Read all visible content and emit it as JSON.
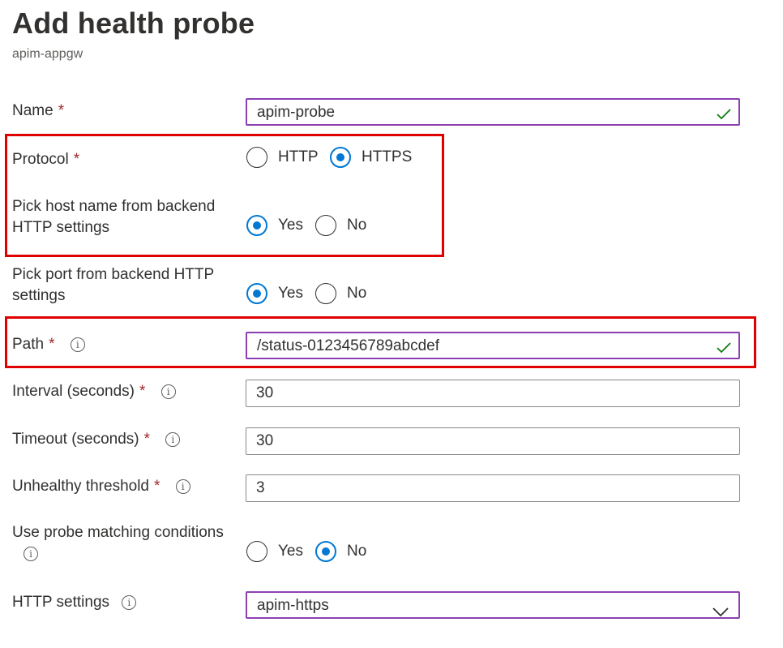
{
  "page": {
    "title": "Add health probe",
    "subtitle": "apim-appgw"
  },
  "form": {
    "name": {
      "label": "Name",
      "required": "*",
      "value": "apim-probe"
    },
    "protocol": {
      "label": "Protocol",
      "required": "*",
      "options": [
        "HTTP",
        "HTTPS"
      ],
      "selected": "HTTPS"
    },
    "pick_host": {
      "label_line1": "Pick host name from backend",
      "label_line2": "HTTP settings",
      "options": [
        "Yes",
        "No"
      ],
      "selected": "Yes"
    },
    "pick_port": {
      "label_line1": "Pick port from backend HTTP",
      "label_line2": "settings",
      "options": [
        "Yes",
        "No"
      ],
      "selected": "Yes"
    },
    "path": {
      "label": "Path",
      "required": "*",
      "value": "/status-0123456789abcdef"
    },
    "interval": {
      "label": "Interval (seconds)",
      "required": "*",
      "value": "30"
    },
    "timeout": {
      "label": "Timeout (seconds)",
      "required": "*",
      "value": "30"
    },
    "unhealthy": {
      "label": "Unhealthy threshold",
      "required": "*",
      "value": "3"
    },
    "matching": {
      "label": "Use probe matching conditions",
      "options": [
        "Yes",
        "No"
      ],
      "selected": "No"
    },
    "http_settings": {
      "label": "HTTP settings",
      "value": "apim-https"
    }
  },
  "icons": {
    "info": "info-icon",
    "check": "checkmark-icon",
    "dropdown": "chevron-down-icon"
  },
  "colors": {
    "accent": "#0078d4",
    "focus_border": "#8c3fb3",
    "valid_check": "#107c10",
    "required": "#a4262c",
    "highlight": "#e00000"
  }
}
